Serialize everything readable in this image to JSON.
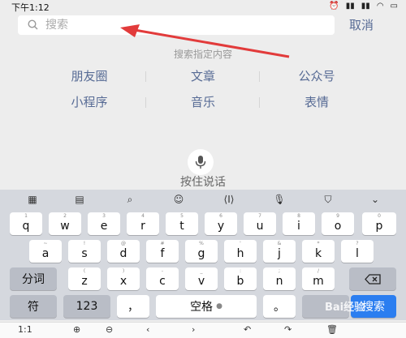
{
  "status": {
    "time": "下午1:12"
  },
  "search": {
    "placeholder": "搜索",
    "cancel": "取消"
  },
  "hint": "搜索指定内容",
  "categories": [
    "朋友圈",
    "文章",
    "公众号",
    "小程序",
    "音乐",
    "表情"
  ],
  "voice": {
    "label": "按住说话"
  },
  "keyboard": {
    "row1": [
      "q",
      "w",
      "e",
      "r",
      "t",
      "y",
      "u",
      "i",
      "o",
      "p"
    ],
    "row1_sub": [
      "1",
      "2",
      "3",
      "4",
      "5",
      "6",
      "7",
      "8",
      "9",
      "0"
    ],
    "row2": [
      "a",
      "s",
      "d",
      "f",
      "g",
      "h",
      "j",
      "k",
      "l"
    ],
    "row2_sub": [
      "~",
      "!",
      "@",
      "#",
      "%",
      "'",
      "&",
      "*",
      "?"
    ],
    "row3": [
      "z",
      "x",
      "c",
      "v",
      "b",
      "n",
      "m"
    ],
    "row3_sub": [
      "(",
      ")",
      "-",
      "_",
      ":",
      ";",
      "/"
    ],
    "fenci": "分词",
    "fu": "符",
    "num": "123",
    "comma": "，",
    "space": "空格",
    "period": "。",
    "search_key": "搜索"
  },
  "bottombar": {
    "zoom": "1:1"
  },
  "watermark": "Bai经验"
}
